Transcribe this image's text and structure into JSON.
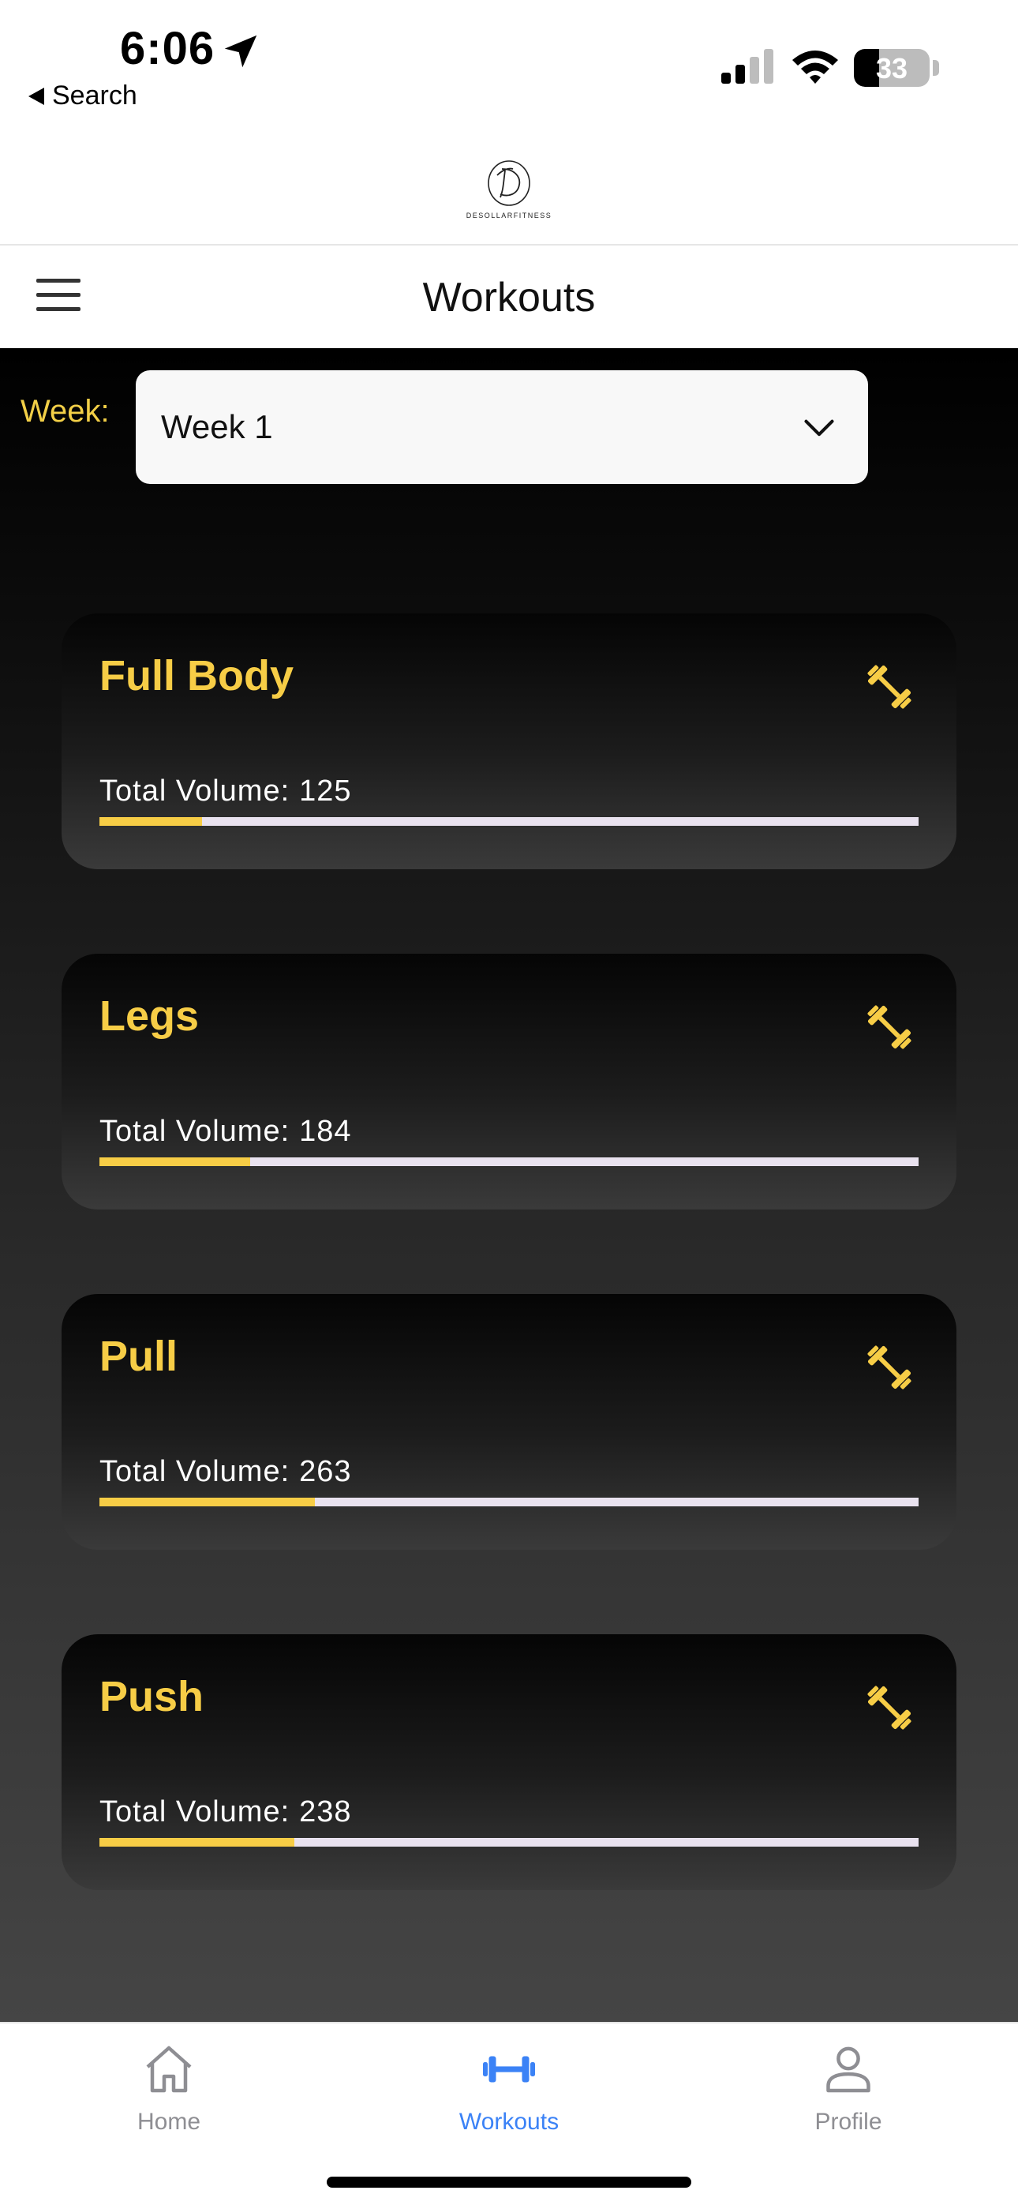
{
  "status_bar": {
    "time": "6:06",
    "back_label": "Search",
    "battery_level": "33",
    "battery_fraction": 0.33
  },
  "brand": {
    "logo_text": "DESOLLARFITNESS"
  },
  "header": {
    "title": "Workouts"
  },
  "week": {
    "label": "Week:",
    "selected": "Week 1"
  },
  "workouts": [
    {
      "title": "Full Body",
      "volume_label": "Total Volume:",
      "volume": "125",
      "progress": 0.125,
      "icon": "dumbbell-icon"
    },
    {
      "title": "Legs",
      "volume_label": "Total Volume:",
      "volume": "184",
      "progress": 0.184,
      "icon": "dumbbell-icon"
    },
    {
      "title": "Pull",
      "volume_label": "Total Volume:",
      "volume": "263",
      "progress": 0.263,
      "icon": "dumbbell-icon"
    },
    {
      "title": "Push",
      "volume_label": "Total Volume:",
      "volume": "238",
      "progress": 0.238,
      "icon": "dumbbell-icon"
    }
  ],
  "tabbar": {
    "items": [
      {
        "label": "Home",
        "icon": "home-icon",
        "active": false
      },
      {
        "label": "Workouts",
        "icon": "dumbbell-icon",
        "active": true
      },
      {
        "label": "Profile",
        "icon": "person-icon",
        "active": false
      }
    ]
  },
  "colors": {
    "accent": "#f7cd46",
    "active_tab": "#3b82f6",
    "inactive_tab": "#8e8e93",
    "progress_track": "#e9e2ef"
  }
}
